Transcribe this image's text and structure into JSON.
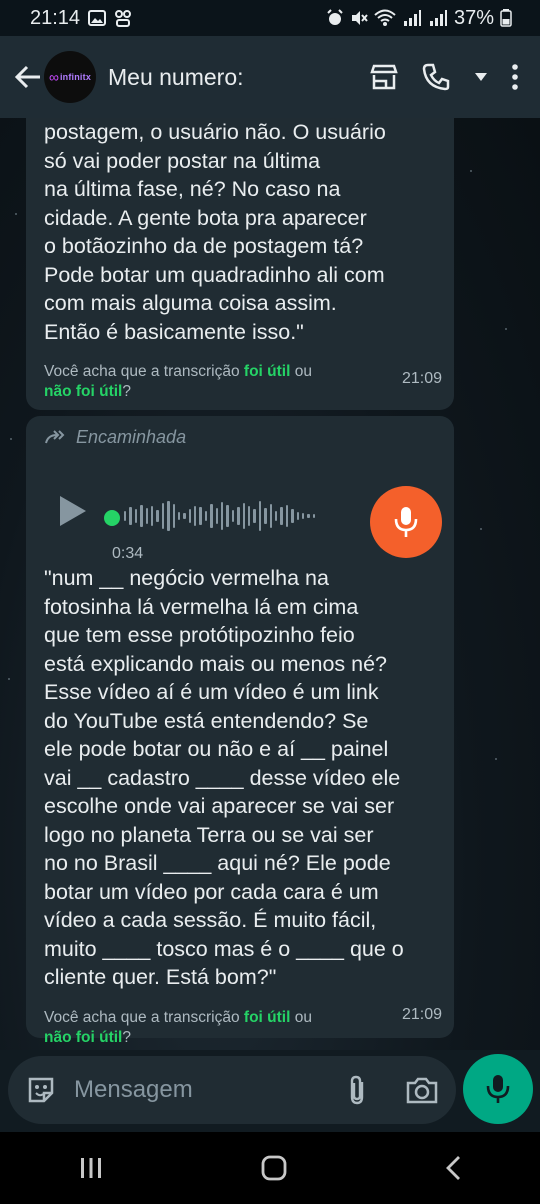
{
  "status_bar": {
    "time": "21:14",
    "battery": "37%"
  },
  "header": {
    "contact_name": "Meu numero:",
    "avatar_logo_text": "infinitx"
  },
  "messages": [
    {
      "text": "postagem, o usuário não. O usuário\nsó vai poder postar na última\nna última fase, né? No caso na\ncidade. A gente bota pra aparecer\no botãozinho da de postagem tá?\nPode botar um quadradinho ali com\ncom mais alguma coisa assim.\nEntão é basicamente isso.\"",
      "feedback_prefix": "Você acha que a transcrição ",
      "feedback_yes": "foi útil",
      "feedback_or": " ou",
      "feedback_no": "não foi útil",
      "feedback_suffix": "?",
      "time": "21:09"
    },
    {
      "forwarded_label": "Encaminhada",
      "audio_duration": "0:34",
      "text": "\"num __ negócio vermelha na\nfotosinha lá vermelha lá em cima\nque tem esse protótipozinho feio\nestá explicando mais ou menos né?\nEsse vídeo aí é um vídeo é um link\ndo YouTube está entendendo? Se\nele pode botar ou não e aí __ painel\nvai __ cadastro ____ desse vídeo ele\nescolhe onde vai aparecer se vai ser\nlogo no planeta Terra ou se vai ser\nno no Brasil ____ aqui né? Ele pode\nbotar um vídeo por cada cara é um\nvídeo a cada sessão. É muito fácil,\nmuito ____ tosco mas é o ____ que o\ncliente quer. Está bom?\"",
      "feedback_prefix": "Você acha que a transcrição ",
      "feedback_yes": "foi útil",
      "feedback_or": " ou",
      "feedback_no": "não foi útil",
      "feedback_suffix": "?",
      "time": "21:09"
    }
  ],
  "composer": {
    "placeholder": "Mensagem"
  },
  "colors": {
    "accent_green": "#25d366",
    "mic_orange": "#f4602b",
    "send_green": "#00a884",
    "bubble": "#202c33",
    "header": "#1f2c34"
  }
}
